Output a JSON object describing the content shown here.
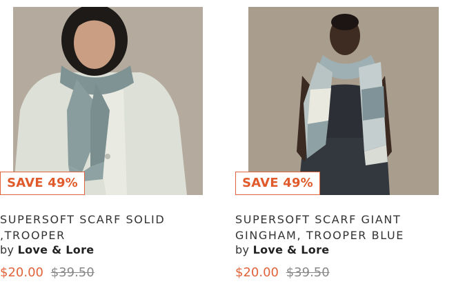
{
  "products": [
    {
      "badge": "SAVE 49%",
      "title_line1": "SUPERSOFT SCARF SOLID",
      "title_line2": ",TROOPER",
      "by_prefix": "by",
      "brand": "Love & Lore",
      "sale_price": "$20.00",
      "original_price": "$39.50"
    },
    {
      "badge": "SAVE 49%",
      "title_line1": "SUPERSOFT SCARF GIANT",
      "title_line2": "GINGHAM, TROOPER BLUE",
      "by_prefix": "by",
      "brand": "Love & Lore",
      "sale_price": "$20.00",
      "original_price": "$39.50"
    }
  ],
  "colors": {
    "accent": "#e0633a",
    "text": "#333333",
    "strike": "#888888",
    "photo_bg": "#b8aea1"
  }
}
